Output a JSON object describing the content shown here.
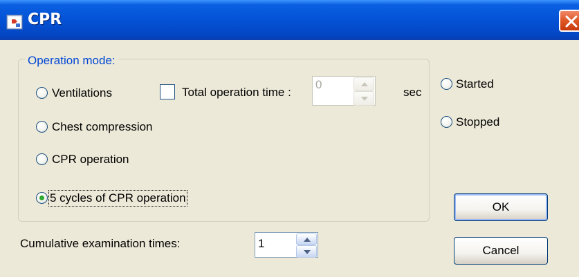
{
  "window": {
    "title": "CPR",
    "close_icon": "close-icon",
    "app_icon": "app-icon"
  },
  "group": {
    "legend": "Operation mode:",
    "modes": [
      {
        "label": "Ventilations",
        "selected": false
      },
      {
        "label": "Chest compression",
        "selected": false
      },
      {
        "label": "CPR operation",
        "selected": false
      },
      {
        "label": "5 cycles of CPR operation",
        "selected": true
      }
    ],
    "total_time_checkbox": {
      "label": "Total operation time :",
      "checked": false
    },
    "total_time_value": "0",
    "total_time_unit": "sec"
  },
  "state": {
    "started_label": "Started",
    "stopped_label": "Stopped"
  },
  "cumulative": {
    "label": "Cumulative examination times:",
    "value": "1"
  },
  "buttons": {
    "ok": "OK",
    "cancel": "Cancel"
  },
  "colors": {
    "titlebar": "#0452d6",
    "legend_text": "#0046d5",
    "dialog_bg": "#ece9d8",
    "radio_dot": "#2fa82f"
  }
}
